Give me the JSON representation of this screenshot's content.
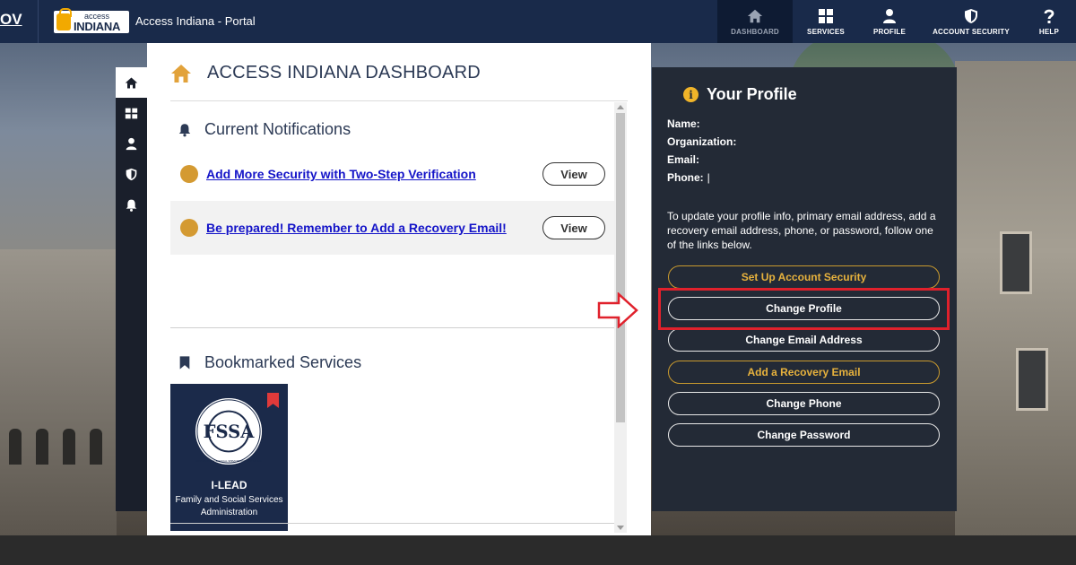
{
  "app": {
    "gov_label": "OV",
    "logo_small": "access",
    "logo_big": "INDIANA",
    "portal_title": "Access Indiana - Portal"
  },
  "topnav": {
    "items": [
      {
        "label": "DASHBOARD",
        "icon": "home-icon",
        "active": true
      },
      {
        "label": "SERVICES",
        "icon": "grid-icon",
        "active": false
      },
      {
        "label": "PROFILE",
        "icon": "user-icon",
        "active": false
      },
      {
        "label": "ACCOUNT SECURITY",
        "icon": "shield-icon",
        "active": false
      },
      {
        "label": "HELP",
        "icon": "question-icon",
        "active": false
      }
    ]
  },
  "sidebar": {
    "icons": [
      "home-icon",
      "grid-icon",
      "user-icon",
      "shield-icon",
      "bell-icon"
    ]
  },
  "dashboard": {
    "title": "ACCESS INDIANA DASHBOARD",
    "notifications_heading": "Current Notifications",
    "notifications": [
      {
        "text": "Add More Security with Two-Step Verification",
        "button": "View"
      },
      {
        "text": "Be prepared! Remember to Add a Recovery Email!",
        "button": "View"
      }
    ],
    "bookmarks_heading": "Bookmarked Services",
    "bookmark": {
      "name": "I-LEAD",
      "description": "Family and Social Services Administration",
      "seal_text": "INDIANA FAMILY & SOCIAL SERVICES ADMINISTRATION",
      "seal_letters": "FSSA"
    }
  },
  "profile": {
    "heading": "Your Profile",
    "info_icon_glyph": "i",
    "fields": [
      {
        "label": "Name:",
        "value": ""
      },
      {
        "label": "Organization:",
        "value": ""
      },
      {
        "label": "Email:",
        "value": ""
      },
      {
        "label": "Phone:",
        "value": "|"
      }
    ],
    "note": "To update your profile info, primary email address, add a recovery email address, phone, or password, follow one of the links below.",
    "buttons": [
      {
        "label": "Set Up Account Security",
        "style": "gold"
      },
      {
        "label": "Change Profile",
        "style": "white"
      },
      {
        "label": "Change Email Address",
        "style": "white"
      },
      {
        "label": "Add a Recovery Email",
        "style": "gold"
      },
      {
        "label": "Change Phone",
        "style": "white"
      },
      {
        "label": "Change Password",
        "style": "white"
      }
    ]
  },
  "colors": {
    "nav_bg": "#192a4a",
    "accent_gold": "#f0b429",
    "link_blue": "#1414c8",
    "highlight_red": "#e0212c",
    "notification_dot": "#d49a32"
  }
}
